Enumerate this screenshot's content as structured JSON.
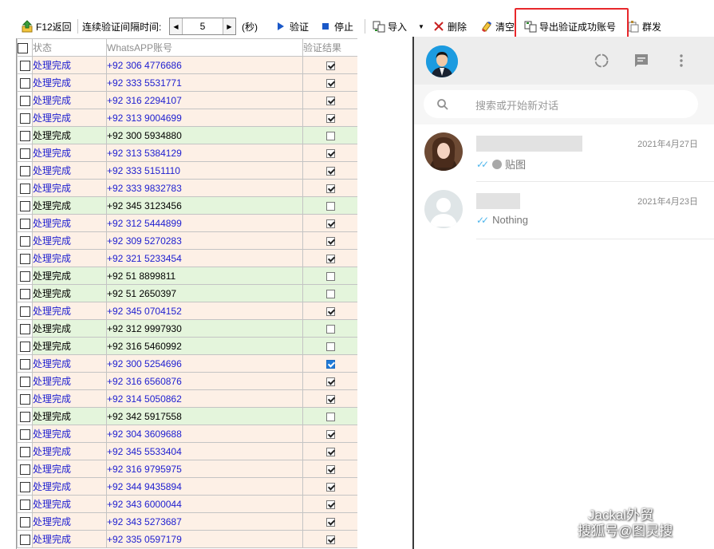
{
  "toolbar": {
    "back_label": "F12返回",
    "interval_label": "连续验证间隔时间:",
    "interval_value": "5",
    "interval_unit": "(秒)",
    "verify_label": "验证",
    "stop_label": "停止",
    "import_label": "导入",
    "delete_label": "删除",
    "clear_label": "清空",
    "export_label": "导出验证成功账号",
    "broadcast_label": "群发"
  },
  "grid": {
    "columns": [
      "状态",
      "WhatsAPP账号",
      "验证结果"
    ],
    "rows": [
      {
        "status": "处理完成",
        "phone": "+92 306 4776686",
        "verified": true
      },
      {
        "status": "处理完成",
        "phone": "+92 333 5531771",
        "verified": true
      },
      {
        "status": "处理完成",
        "phone": "+92 316 2294107",
        "verified": true
      },
      {
        "status": "处理完成",
        "phone": "+92 313 9004699",
        "verified": true
      },
      {
        "status": "处理完成",
        "phone": "+92 300 5934880",
        "verified": false
      },
      {
        "status": "处理完成",
        "phone": "+92 313 5384129",
        "verified": true
      },
      {
        "status": "处理完成",
        "phone": "+92 333 5151110",
        "verified": true
      },
      {
        "status": "处理完成",
        "phone": "+92 333 9832783",
        "verified": true
      },
      {
        "status": "处理完成",
        "phone": "+92 345 3123456",
        "verified": false
      },
      {
        "status": "处理完成",
        "phone": "+92 312 5444899",
        "verified": true
      },
      {
        "status": "处理完成",
        "phone": "+92 309 5270283",
        "verified": true
      },
      {
        "status": "处理完成",
        "phone": "+92 321 5233454",
        "verified": true
      },
      {
        "status": "处理完成",
        "phone": "+92 51 8899811",
        "verified": false
      },
      {
        "status": "处理完成",
        "phone": "+92 51 2650397",
        "verified": false
      },
      {
        "status": "处理完成",
        "phone": "+92 345 0704152",
        "verified": true
      },
      {
        "status": "处理完成",
        "phone": "+92 312 9997930",
        "verified": false
      },
      {
        "status": "处理完成",
        "phone": "+92 316 5460992",
        "verified": false
      },
      {
        "status": "处理完成",
        "phone": "+92 300 5254696",
        "verified": true,
        "focused": true
      },
      {
        "status": "处理完成",
        "phone": "+92 316 6560876",
        "verified": true
      },
      {
        "status": "处理完成",
        "phone": "+92 314 5050862",
        "verified": true
      },
      {
        "status": "处理完成",
        "phone": "+92 342 5917558",
        "verified": false
      },
      {
        "status": "处理完成",
        "phone": "+92 304 3609688",
        "verified": true
      },
      {
        "status": "处理完成",
        "phone": "+92 345 5533404",
        "verified": true
      },
      {
        "status": "处理完成",
        "phone": "+92 316 9795975",
        "verified": true
      },
      {
        "status": "处理完成",
        "phone": "+92 344 9435894",
        "verified": true
      },
      {
        "status": "处理完成",
        "phone": "+92 343 6000044",
        "verified": true
      },
      {
        "status": "处理完成",
        "phone": "+92 343 5273687",
        "verified": true
      },
      {
        "status": "处理完成",
        "phone": "+92 335 0597179",
        "verified": true
      }
    ]
  },
  "whatsapp": {
    "search_placeholder": "搜索或开始新对话",
    "chats": [
      {
        "date": "2021年4月27日",
        "message": "贴图"
      },
      {
        "date": "2021年4月23日",
        "message": "Nothing"
      }
    ]
  },
  "watermark": {
    "line1": "Jackal外贸",
    "line2": "搜狐号@图灵搜"
  },
  "colors": {
    "ok_row": "#fdf0e6",
    "fail_row": "#e4f5dc",
    "ok_text": "#2020d0",
    "highlight": "#e8272b",
    "tick_blue": "#4fb6ec"
  }
}
